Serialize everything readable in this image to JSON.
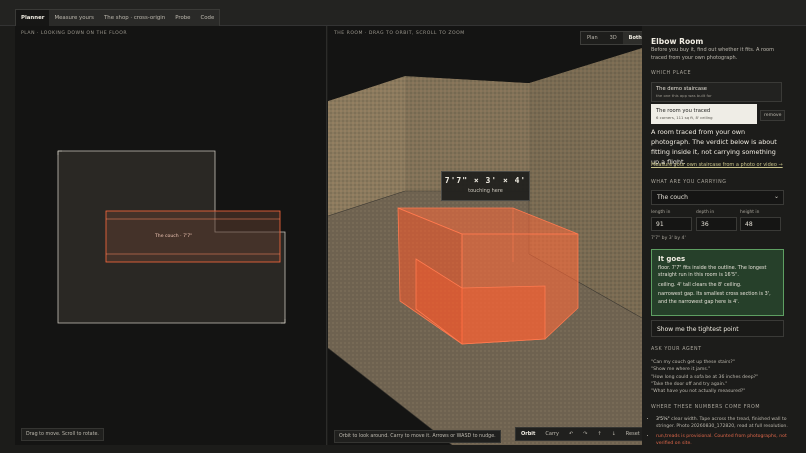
{
  "tabs": [
    "Planner",
    "Measure yours",
    "The shop · cross-origin",
    "Probe",
    "Code"
  ],
  "plan": {
    "caption": "Plan · looking down on the floor",
    "couch_label": "The couch · 7'7\"",
    "hint": "Drag to move. Scroll to rotate."
  },
  "view3d": {
    "caption": "The room · drag to orbit, scroll to zoom",
    "view_modes": [
      "Plan",
      "3D",
      "Both"
    ],
    "dimension_readout": "7'7\" × 3' × 4'",
    "touching_label": "touching here",
    "hint": "Orbit to look around. Carry to move it. Arrows or WASD to nudge.",
    "modes": [
      "Orbit",
      "Carry"
    ],
    "nudge_buttons": [
      "↶",
      "↷",
      "↑",
      "↓"
    ],
    "reset_label": "Reset"
  },
  "side": {
    "title": "Elbow Room",
    "description": "Before you buy it, find out whether it fits. A room traced from your own photograph.",
    "which_place_heading": "Which place",
    "places": [
      {
        "title": "The demo staircase",
        "subtitle": "the one this app was built for"
      },
      {
        "title": "The room you traced",
        "subtitle": "6 corners, 111 sq ft, 8' ceiling"
      }
    ],
    "remove_label": "remove",
    "lede": "A room traced from your own photograph. The verdict below is about fitting inside it, not carrying something up a flight.",
    "measure_link": "Measure your own staircase from a photo or video →",
    "carrying_heading": "What are you carrying",
    "item_selected": "The couch",
    "fields": {
      "length_label": "length in",
      "length_value": "91",
      "depth_label": "depth in",
      "depth_value": "36",
      "height_label": "height in",
      "height_value": "48"
    },
    "dims_note": "7'7\" by 3' by 4'",
    "result": {
      "title": "It goes",
      "line1": "floor. 7'7\" fits inside the outline. The longest straight run in this room is 16'5\".",
      "line2": "ceiling. 4' tall clears the 8' ceiling.",
      "line3": "narrowest gap. Its smallest cross section is 3', and the narrowest gap here is 4'."
    },
    "tightest_button": "Show me the tightest point",
    "agent_heading": "Ask your agent",
    "quotes": [
      "\"Can my couch get up these stairs?\"",
      "\"Show me where it jams.\"",
      "\"How long could a sofa be at 36 inches deep?\"",
      "\"Take the door off and try again.\"",
      "\"What have you not actually measured?\""
    ],
    "sources_heading": "Where these numbers come from",
    "fact1_strong": "3'5⅝\"",
    "fact1_rest": " clear width. Tape across the tread, finished wall to stringer. Photo 20260830_172820, read at full resolution.",
    "fact2_warn": "run,treads",
    "fact2_rest": " is provisional. Counted from photographs, not verified on site."
  },
  "colors": {
    "accent_green": "#5e9f62",
    "couch_orange": "#ff5a2a",
    "link_yellow": "#c9c38a"
  }
}
